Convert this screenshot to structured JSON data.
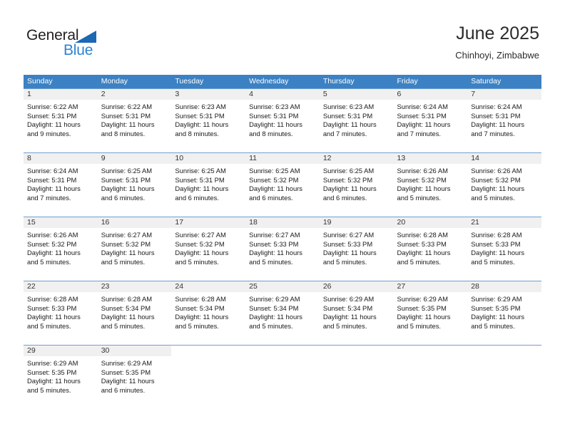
{
  "brand": {
    "name_part1": "General",
    "name_part2": "Blue",
    "accent_color": "#2e83d2",
    "triangle_color": "#1b68b3"
  },
  "header": {
    "title": "June 2025",
    "subtitle": "Chinhoyi, Zimbabwe"
  },
  "calendar": {
    "header_bg": "#3c81c3",
    "daynum_bg": "#f0f0f0",
    "weekdays": [
      "Sunday",
      "Monday",
      "Tuesday",
      "Wednesday",
      "Thursday",
      "Friday",
      "Saturday"
    ],
    "weeks": [
      [
        {
          "day": "1",
          "sunrise": "Sunrise: 6:22 AM",
          "sunset": "Sunset: 5:31 PM",
          "daylight1": "Daylight: 11 hours",
          "daylight2": "and 9 minutes."
        },
        {
          "day": "2",
          "sunrise": "Sunrise: 6:22 AM",
          "sunset": "Sunset: 5:31 PM",
          "daylight1": "Daylight: 11 hours",
          "daylight2": "and 8 minutes."
        },
        {
          "day": "3",
          "sunrise": "Sunrise: 6:23 AM",
          "sunset": "Sunset: 5:31 PM",
          "daylight1": "Daylight: 11 hours",
          "daylight2": "and 8 minutes."
        },
        {
          "day": "4",
          "sunrise": "Sunrise: 6:23 AM",
          "sunset": "Sunset: 5:31 PM",
          "daylight1": "Daylight: 11 hours",
          "daylight2": "and 8 minutes."
        },
        {
          "day": "5",
          "sunrise": "Sunrise: 6:23 AM",
          "sunset": "Sunset: 5:31 PM",
          "daylight1": "Daylight: 11 hours",
          "daylight2": "and 7 minutes."
        },
        {
          "day": "6",
          "sunrise": "Sunrise: 6:24 AM",
          "sunset": "Sunset: 5:31 PM",
          "daylight1": "Daylight: 11 hours",
          "daylight2": "and 7 minutes."
        },
        {
          "day": "7",
          "sunrise": "Sunrise: 6:24 AM",
          "sunset": "Sunset: 5:31 PM",
          "daylight1": "Daylight: 11 hours",
          "daylight2": "and 7 minutes."
        }
      ],
      [
        {
          "day": "8",
          "sunrise": "Sunrise: 6:24 AM",
          "sunset": "Sunset: 5:31 PM",
          "daylight1": "Daylight: 11 hours",
          "daylight2": "and 7 minutes."
        },
        {
          "day": "9",
          "sunrise": "Sunrise: 6:25 AM",
          "sunset": "Sunset: 5:31 PM",
          "daylight1": "Daylight: 11 hours",
          "daylight2": "and 6 minutes."
        },
        {
          "day": "10",
          "sunrise": "Sunrise: 6:25 AM",
          "sunset": "Sunset: 5:31 PM",
          "daylight1": "Daylight: 11 hours",
          "daylight2": "and 6 minutes."
        },
        {
          "day": "11",
          "sunrise": "Sunrise: 6:25 AM",
          "sunset": "Sunset: 5:32 PM",
          "daylight1": "Daylight: 11 hours",
          "daylight2": "and 6 minutes."
        },
        {
          "day": "12",
          "sunrise": "Sunrise: 6:25 AM",
          "sunset": "Sunset: 5:32 PM",
          "daylight1": "Daylight: 11 hours",
          "daylight2": "and 6 minutes."
        },
        {
          "day": "13",
          "sunrise": "Sunrise: 6:26 AM",
          "sunset": "Sunset: 5:32 PM",
          "daylight1": "Daylight: 11 hours",
          "daylight2": "and 5 minutes."
        },
        {
          "day": "14",
          "sunrise": "Sunrise: 6:26 AM",
          "sunset": "Sunset: 5:32 PM",
          "daylight1": "Daylight: 11 hours",
          "daylight2": "and 5 minutes."
        }
      ],
      [
        {
          "day": "15",
          "sunrise": "Sunrise: 6:26 AM",
          "sunset": "Sunset: 5:32 PM",
          "daylight1": "Daylight: 11 hours",
          "daylight2": "and 5 minutes."
        },
        {
          "day": "16",
          "sunrise": "Sunrise: 6:27 AM",
          "sunset": "Sunset: 5:32 PM",
          "daylight1": "Daylight: 11 hours",
          "daylight2": "and 5 minutes."
        },
        {
          "day": "17",
          "sunrise": "Sunrise: 6:27 AM",
          "sunset": "Sunset: 5:32 PM",
          "daylight1": "Daylight: 11 hours",
          "daylight2": "and 5 minutes."
        },
        {
          "day": "18",
          "sunrise": "Sunrise: 6:27 AM",
          "sunset": "Sunset: 5:33 PM",
          "daylight1": "Daylight: 11 hours",
          "daylight2": "and 5 minutes."
        },
        {
          "day": "19",
          "sunrise": "Sunrise: 6:27 AM",
          "sunset": "Sunset: 5:33 PM",
          "daylight1": "Daylight: 11 hours",
          "daylight2": "and 5 minutes."
        },
        {
          "day": "20",
          "sunrise": "Sunrise: 6:28 AM",
          "sunset": "Sunset: 5:33 PM",
          "daylight1": "Daylight: 11 hours",
          "daylight2": "and 5 minutes."
        },
        {
          "day": "21",
          "sunrise": "Sunrise: 6:28 AM",
          "sunset": "Sunset: 5:33 PM",
          "daylight1": "Daylight: 11 hours",
          "daylight2": "and 5 minutes."
        }
      ],
      [
        {
          "day": "22",
          "sunrise": "Sunrise: 6:28 AM",
          "sunset": "Sunset: 5:33 PM",
          "daylight1": "Daylight: 11 hours",
          "daylight2": "and 5 minutes."
        },
        {
          "day": "23",
          "sunrise": "Sunrise: 6:28 AM",
          "sunset": "Sunset: 5:34 PM",
          "daylight1": "Daylight: 11 hours",
          "daylight2": "and 5 minutes."
        },
        {
          "day": "24",
          "sunrise": "Sunrise: 6:28 AM",
          "sunset": "Sunset: 5:34 PM",
          "daylight1": "Daylight: 11 hours",
          "daylight2": "and 5 minutes."
        },
        {
          "day": "25",
          "sunrise": "Sunrise: 6:29 AM",
          "sunset": "Sunset: 5:34 PM",
          "daylight1": "Daylight: 11 hours",
          "daylight2": "and 5 minutes."
        },
        {
          "day": "26",
          "sunrise": "Sunrise: 6:29 AM",
          "sunset": "Sunset: 5:34 PM",
          "daylight1": "Daylight: 11 hours",
          "daylight2": "and 5 minutes."
        },
        {
          "day": "27",
          "sunrise": "Sunrise: 6:29 AM",
          "sunset": "Sunset: 5:35 PM",
          "daylight1": "Daylight: 11 hours",
          "daylight2": "and 5 minutes."
        },
        {
          "day": "28",
          "sunrise": "Sunrise: 6:29 AM",
          "sunset": "Sunset: 5:35 PM",
          "daylight1": "Daylight: 11 hours",
          "daylight2": "and 5 minutes."
        }
      ],
      [
        {
          "day": "29",
          "sunrise": "Sunrise: 6:29 AM",
          "sunset": "Sunset: 5:35 PM",
          "daylight1": "Daylight: 11 hours",
          "daylight2": "and 5 minutes."
        },
        {
          "day": "30",
          "sunrise": "Sunrise: 6:29 AM",
          "sunset": "Sunset: 5:35 PM",
          "daylight1": "Daylight: 11 hours",
          "daylight2": "and 6 minutes."
        },
        {
          "day": "",
          "sunrise": "",
          "sunset": "",
          "daylight1": "",
          "daylight2": ""
        },
        {
          "day": "",
          "sunrise": "",
          "sunset": "",
          "daylight1": "",
          "daylight2": ""
        },
        {
          "day": "",
          "sunrise": "",
          "sunset": "",
          "daylight1": "",
          "daylight2": ""
        },
        {
          "day": "",
          "sunrise": "",
          "sunset": "",
          "daylight1": "",
          "daylight2": ""
        },
        {
          "day": "",
          "sunrise": "",
          "sunset": "",
          "daylight1": "",
          "daylight2": ""
        }
      ]
    ]
  }
}
